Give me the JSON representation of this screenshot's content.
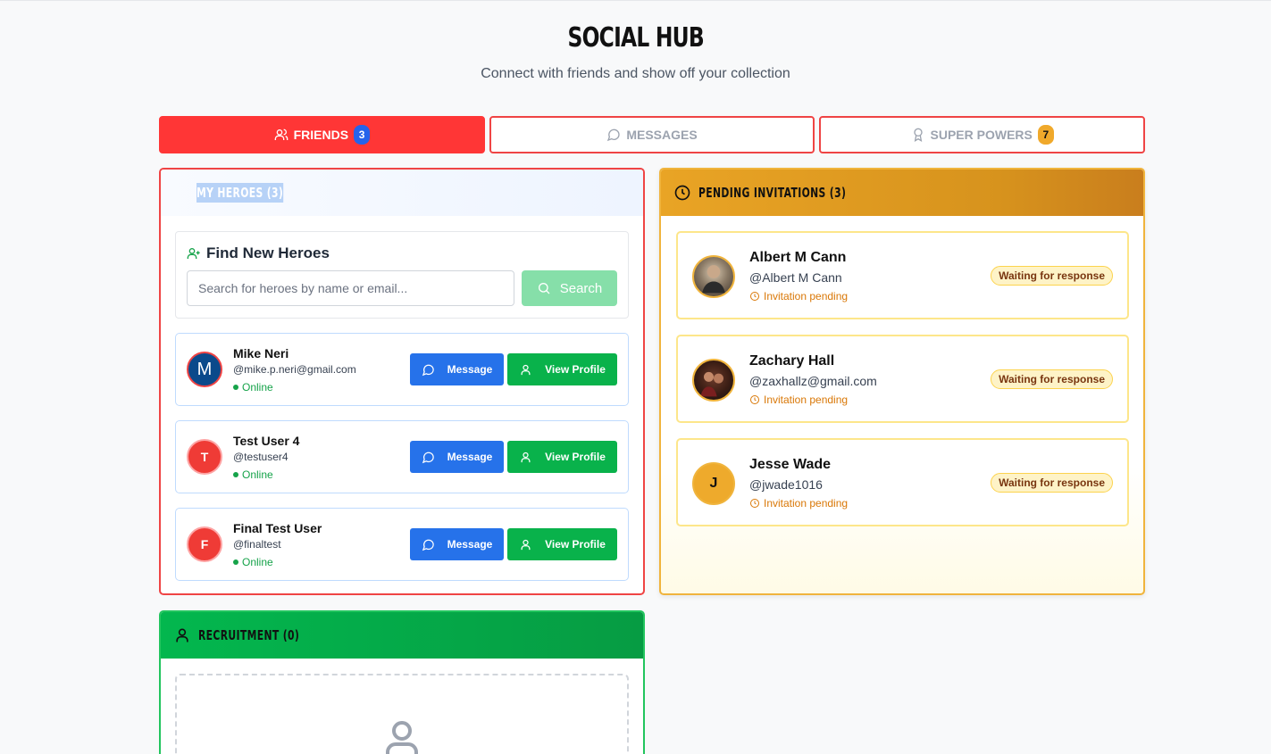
{
  "header": {
    "title": "SOCIAL HUB",
    "subtitle": "Connect with friends and show off your collection"
  },
  "tabs": [
    {
      "label": "FRIENDS",
      "badge": "3",
      "icon": "users-icon",
      "active": true
    },
    {
      "label": "MESSAGES",
      "badge": "",
      "icon": "message-circle-icon",
      "active": false
    },
    {
      "label": "SUPER POWERS",
      "badge": "7",
      "icon": "award-icon",
      "active": false
    }
  ],
  "heroes": {
    "title": "MY HEROES (3)",
    "find": {
      "title": "Find New Heroes",
      "placeholder": "Search for heroes by name or email...",
      "search_label": "Search"
    },
    "friends": [
      {
        "name": "Mike Neri",
        "handle": "@mike.p.neri@gmail.com",
        "status": "Online",
        "initial": "M"
      },
      {
        "name": "Test User 4",
        "handle": "@testuser4",
        "status": "Online",
        "initial": "T"
      },
      {
        "name": "Final Test User",
        "handle": "@finaltest",
        "status": "Online",
        "initial": "F"
      }
    ],
    "message_label": "Message",
    "view_profile_label": "View Profile"
  },
  "pending": {
    "title": "PENDING INVITATIONS (3)",
    "invites": [
      {
        "name": "Albert M Cann",
        "handle": "@Albert M Cann",
        "status": "Invitation pending",
        "badge": "Waiting for response"
      },
      {
        "name": "Zachary Hall",
        "handle": "@zaxhallz@gmail.com",
        "status": "Invitation pending",
        "badge": "Waiting for response"
      },
      {
        "name": "Jesse Wade",
        "handle": "@jwade1016",
        "status": "Invitation pending",
        "badge": "Waiting for response",
        "initial": "J"
      }
    ]
  },
  "recruitment": {
    "title": "RECRUITMENT (0)"
  },
  "colors": {
    "accent_red": "#ff3636",
    "message_blue": "#2672ea",
    "profile_green": "#09b24b",
    "pending_gold": "#e9a425",
    "recruit_green": "#03b74e"
  }
}
